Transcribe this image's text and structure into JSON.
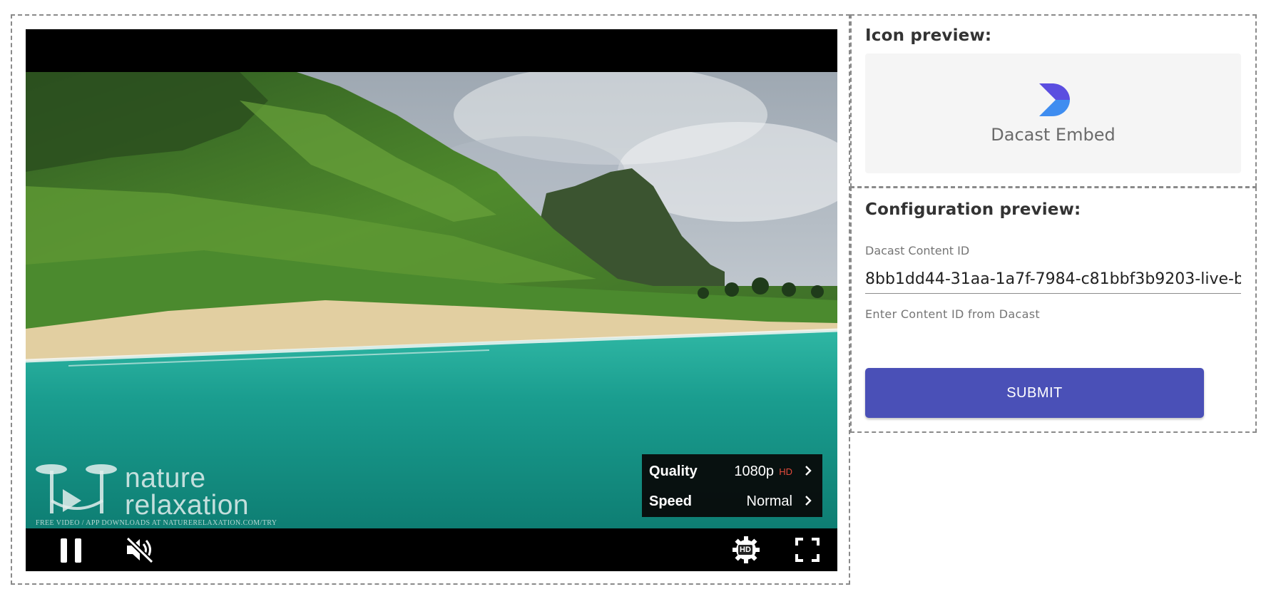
{
  "video": {
    "watermark": {
      "line1": "nature",
      "line2": "relaxation",
      "tagline": "FREE VIDEO / APP DOWNLOADS AT NATURERELAXATION.COM/TRY"
    },
    "settings_menu": {
      "quality_label": "Quality",
      "quality_value": "1080p",
      "quality_badge": "HD",
      "speed_label": "Speed",
      "speed_value": "Normal"
    },
    "controls": {
      "play_state": "playing",
      "muted": true,
      "settings_badge": "HD"
    }
  },
  "icon_preview": {
    "heading": "Icon preview:",
    "app_name": "Dacast Embed",
    "logo_colors": [
      "#5b4ee0",
      "#3f8df0"
    ]
  },
  "config_preview": {
    "heading": "Configuration preview:",
    "field_label": "Dacast Content ID",
    "field_value": "8bb1dd44-31aa-1a7f-7984-c81bbf3b9203-live-b",
    "helper_text": "Enter Content ID from Dacast",
    "submit_label": "SUBMIT",
    "submit_color": "#4a50b7"
  }
}
